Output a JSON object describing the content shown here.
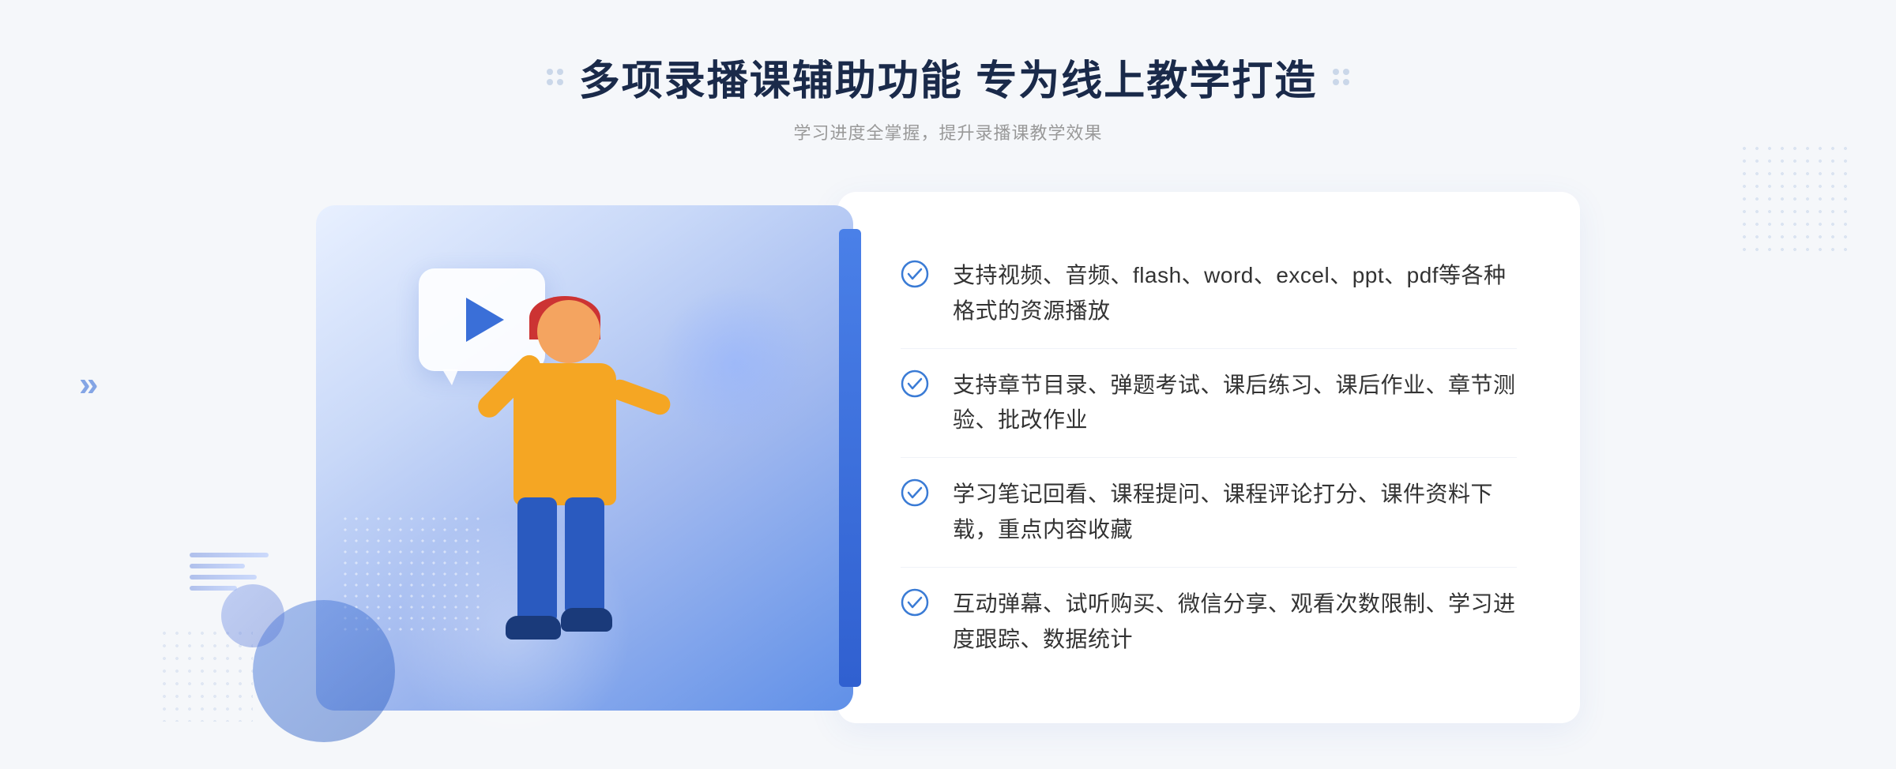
{
  "page": {
    "background_color": "#f5f7fa"
  },
  "header": {
    "main_title": "多项录播课辅助功能 专为线上教学打造",
    "sub_title": "学习进度全掌握，提升录播课教学效果"
  },
  "features": [
    {
      "id": 1,
      "text": "支持视频、音频、flash、word、excel、ppt、pdf等各种格式的资源播放"
    },
    {
      "id": 2,
      "text": "支持章节目录、弹题考试、课后练习、课后作业、章节测验、批改作业"
    },
    {
      "id": 3,
      "text": "学习笔记回看、课程提问、课程评论打分、课件资料下载，重点内容收藏"
    },
    {
      "id": 4,
      "text": "互动弹幕、试听购买、微信分享、观看次数限制、学习进度跟踪、数据统计"
    }
  ],
  "icons": {
    "check": "check-circle-icon",
    "play": "play-icon",
    "arrow_left": "»"
  },
  "colors": {
    "primary_blue": "#3a6fd8",
    "title_dark": "#1a2a4a",
    "text_gray": "#333333",
    "subtitle_gray": "#999999",
    "gradient_start": "#e8f0ff",
    "gradient_end": "#6090e8"
  }
}
